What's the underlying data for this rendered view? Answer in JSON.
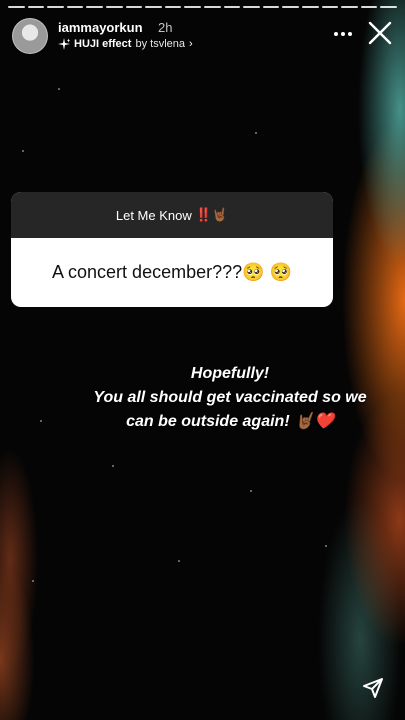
{
  "story": {
    "segments": 20,
    "username": "iammayorkun",
    "time": "2h",
    "effect_name": "HUJI effect",
    "effect_by": "by tsvlena",
    "effect_chevron": "›"
  },
  "question": {
    "title": "Let Me Know",
    "title_emoji": "‼️🤘🏾",
    "text": "A concert december???🥺 🥺"
  },
  "answer": {
    "line1": "Hopefully!",
    "line2": "You all should get vaccinated so we",
    "line3": "can be outside again! 🤘🏾❤️"
  },
  "icons": {
    "more": "more-options-icon",
    "close": "close-icon",
    "send": "send-icon"
  }
}
